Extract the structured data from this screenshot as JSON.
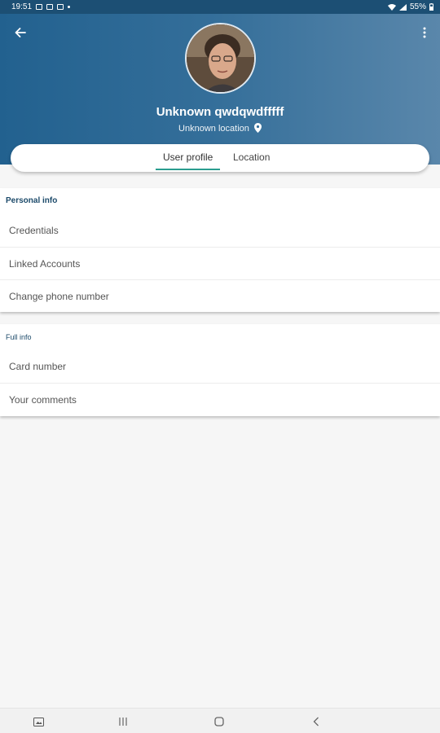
{
  "status_bar": {
    "time": "19:51",
    "battery": "55%"
  },
  "profile": {
    "name": "Unknown qwdqwdfffff",
    "location": "Unknown location"
  },
  "tabs": [
    {
      "label": "User profile",
      "active": true
    },
    {
      "label": "Location",
      "active": false
    }
  ],
  "personal_info": {
    "title": "Personal info",
    "items": [
      "Credentials",
      "Linked Accounts",
      "Change phone number"
    ]
  },
  "full_info": {
    "title": "Full info",
    "items": [
      "Card number",
      "Your comments"
    ]
  },
  "colors": {
    "header": "#2a6693",
    "accent": "#2a9d8f",
    "section_title": "#1c4a6a"
  }
}
